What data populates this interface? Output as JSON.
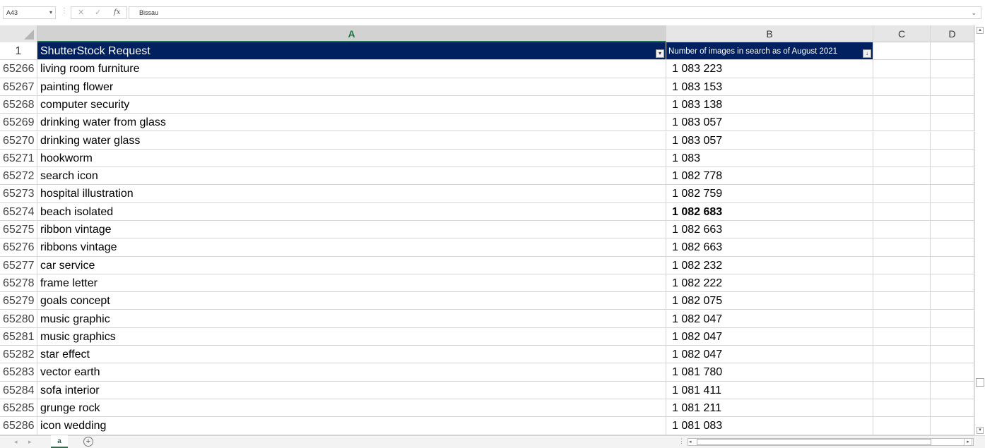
{
  "formula_bar": {
    "name_box": "A43",
    "formula": "Bissau"
  },
  "columns": [
    "A",
    "B",
    "C",
    "D"
  ],
  "header_row": {
    "row_number": "1",
    "col_a": "ShutterStock Request",
    "col_b": "Number of images in search as of August 2021"
  },
  "rows": [
    {
      "n": "65266",
      "a": "living room furniture",
      "b": "1 083 223"
    },
    {
      "n": "65267",
      "a": "painting flower",
      "b": "1 083 153"
    },
    {
      "n": "65268",
      "a": "computer security",
      "b": "1 083 138"
    },
    {
      "n": "65269",
      "a": "drinking water from glass",
      "b": "1 083 057"
    },
    {
      "n": "65270",
      "a": "drinking water glass",
      "b": "1 083 057"
    },
    {
      "n": "65271",
      "a": "hookworm",
      "b": "1 083"
    },
    {
      "n": "65272",
      "a": "search icon",
      "b": "1 082 778"
    },
    {
      "n": "65273",
      "a": "hospital illustration",
      "b": "1 082 759"
    },
    {
      "n": "65274",
      "a": "beach isolated",
      "b": "1 082 683",
      "bold": true
    },
    {
      "n": "65275",
      "a": "ribbon vintage",
      "b": "1 082 663"
    },
    {
      "n": "65276",
      "a": "ribbons vintage",
      "b": "1 082 663"
    },
    {
      "n": "65277",
      "a": "car service",
      "b": "1 082 232"
    },
    {
      "n": "65278",
      "a": "frame letter",
      "b": "1 082 222"
    },
    {
      "n": "65279",
      "a": "goals concept",
      "b": "1 082 075"
    },
    {
      "n": "65280",
      "a": "music graphic",
      "b": "1 082 047"
    },
    {
      "n": "65281",
      "a": "music graphics",
      "b": "1 082 047"
    },
    {
      "n": "65282",
      "a": "star effect",
      "b": "1 082 047"
    },
    {
      "n": "65283",
      "a": "vector earth",
      "b": "1 081 780"
    },
    {
      "n": "65284",
      "a": "sofa interior",
      "b": "1 081 411"
    },
    {
      "n": "65285",
      "a": "grunge rock",
      "b": "1 081 211"
    },
    {
      "n": "65286",
      "a": "icon wedding",
      "b": "1 081 083"
    }
  ],
  "sheet_tab": "a",
  "colors": {
    "header_fill": "#002060",
    "excel_green": "#217346"
  }
}
